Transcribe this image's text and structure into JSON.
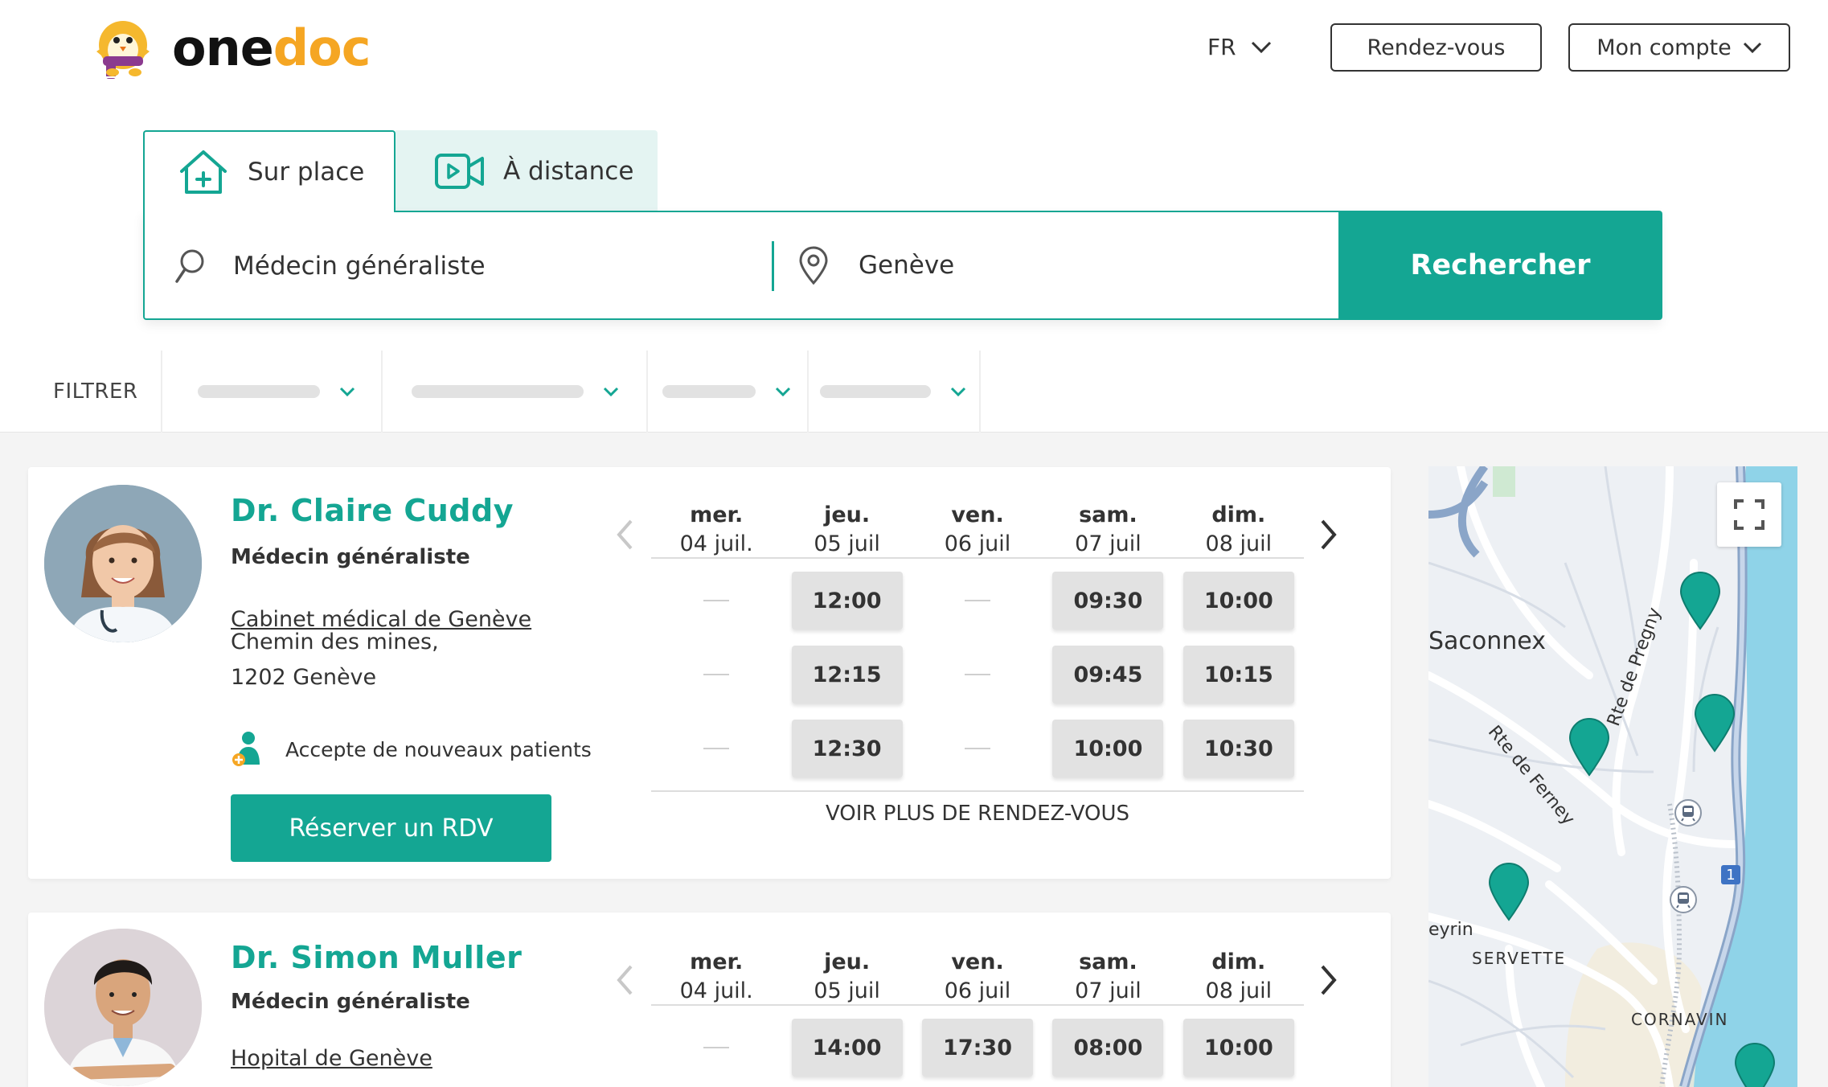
{
  "header": {
    "logo": {
      "part1": "one",
      "part2": "doc"
    },
    "lang": "FR",
    "appointments_label": "Rendez-vous",
    "account_label": "Mon compte"
  },
  "search": {
    "tabs": [
      {
        "label": "Sur place"
      },
      {
        "label": "À distance"
      }
    ],
    "what": "Médecin généraliste",
    "where": "Genève",
    "button": "Rechercher"
  },
  "filters": {
    "label": "FILTRER"
  },
  "doctors": [
    {
      "name": "Dr. Claire Cuddy",
      "specialty": "Médecin généraliste",
      "place": "Cabinet médical de Genève",
      "address_line1": "Chemin des mines,",
      "address_line2": "1202 Genève",
      "accepts": "Accepte de nouveaux patients",
      "book": "Réserver un RDV",
      "days": [
        {
          "name": "mer.",
          "date": "04 juil."
        },
        {
          "name": "jeu.",
          "date": "05 juil"
        },
        {
          "name": "ven.",
          "date": "06 juil"
        },
        {
          "name": "sam.",
          "date": "07 juil"
        },
        {
          "name": "dim.",
          "date": "08 juil"
        }
      ],
      "slots": [
        [
          "",
          "",
          ""
        ],
        [
          "12:00",
          "12:15",
          "12:30"
        ],
        [
          "",
          "",
          ""
        ],
        [
          "09:30",
          "09:45",
          "10:00"
        ],
        [
          "10:00",
          "10:15",
          "10:30"
        ]
      ],
      "more": "VOIR PLUS DE RENDEZ-VOUS"
    },
    {
      "name": "Dr. Simon Muller",
      "specialty": "Médecin généraliste",
      "place": "Hopital de Genève",
      "days": [
        {
          "name": "mer.",
          "date": "04 juil."
        },
        {
          "name": "jeu.",
          "date": "05 juil"
        },
        {
          "name": "ven.",
          "date": "06 juil"
        },
        {
          "name": "sam.",
          "date": "07 juil"
        },
        {
          "name": "dim.",
          "date": "08 juil"
        }
      ],
      "slots": [
        [
          ""
        ],
        [
          "14:00"
        ],
        [
          "17:30"
        ],
        [
          "08:00"
        ],
        [
          "10:00"
        ]
      ]
    }
  ],
  "map": {
    "labels": {
      "saconnex": "Saconnex",
      "ferney": "Rte de Ferney",
      "pregny": "Rte de Pregny",
      "peyrin": "eyrin",
      "servette": "SERVETTE",
      "cornavin": "CORNAVIN",
      "route_badge": "1"
    }
  },
  "colors": {
    "brand": "#14a693",
    "brand_light": "#e4f4f2",
    "logo_orange": "#f5a623",
    "slot_bg": "#e2e2e2",
    "page_bg": "#f4f4f4"
  }
}
